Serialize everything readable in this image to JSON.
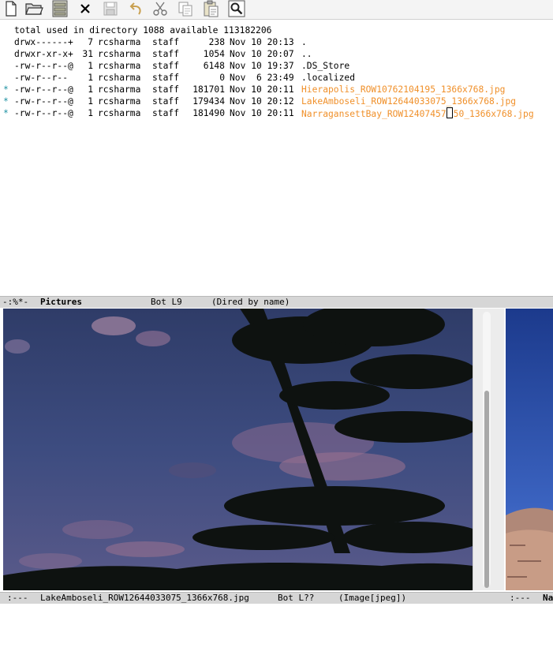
{
  "toolbar": {
    "buttons": [
      {
        "name": "new-file-icon"
      },
      {
        "name": "open-folder-icon"
      },
      {
        "name": "dired-cabinet-icon"
      },
      {
        "name": "close-icon"
      },
      {
        "name": "save-icon"
      },
      {
        "name": "undo-icon"
      },
      {
        "name": "cut-icon"
      },
      {
        "name": "copy-icon"
      },
      {
        "name": "paste-icon"
      },
      {
        "name": "search-icon"
      }
    ]
  },
  "dired": {
    "header": "total used in directory 1088 available 113182206",
    "rows": [
      {
        "mark": "",
        "perm": "drwx------+",
        "links": "7",
        "owner": "rcsharma",
        "group": "staff",
        "size": "238",
        "date": "Nov 10 20:13",
        "name": ".",
        "is_image": false
      },
      {
        "mark": "",
        "perm": "drwxr-xr-x+",
        "links": "31",
        "owner": "rcsharma",
        "group": "staff",
        "size": "1054",
        "date": "Nov 10 20:07",
        "name": "..",
        "is_image": false
      },
      {
        "mark": "",
        "perm": "-rw-r--r--@",
        "links": "1",
        "owner": "rcsharma",
        "group": "staff",
        "size": "6148",
        "date": "Nov 10 19:37",
        "name": ".DS_Store",
        "is_image": false
      },
      {
        "mark": "",
        "perm": "-rw-r--r--",
        "links": "1",
        "owner": "rcsharma",
        "group": "staff",
        "size": "0",
        "date": "Nov  6 23:49",
        "name": ".localized",
        "is_image": false
      },
      {
        "mark": "*",
        "perm": "-rw-r--r--@",
        "links": "1",
        "owner": "rcsharma",
        "group": "staff",
        "size": "181701",
        "date": "Nov 10 20:11",
        "name": "Hierapolis_ROW10762104195_1366x768.jpg",
        "is_image": true
      },
      {
        "mark": "*",
        "perm": "-rw-r--r--@",
        "links": "1",
        "owner": "rcsharma",
        "group": "staff",
        "size": "179434",
        "date": "Nov 10 20:12",
        "name": "LakeAmboseli_ROW12644033075_1366x768.jpg",
        "is_image": true
      },
      {
        "mark": "*",
        "perm": "-rw-r--r--@",
        "links": "1",
        "owner": "rcsharma",
        "group": "staff",
        "size": "181490",
        "date": "Nov 10 20:11",
        "name_before_cursor": "NarragansettBay_ROW12407457",
        "name_after_cursor": "50_1366x768.jpg",
        "is_image": true
      }
    ]
  },
  "modeline_top": {
    "status": "-:%*-",
    "buffer": "Pictures",
    "position": "Bot L9",
    "mode": "(Dired by name)"
  },
  "modeline_bottom": {
    "status": ":---",
    "buffer": "LakeAmboseli_ROW12644033075_1366x768.jpg",
    "position": "Bot L??",
    "mode": "(Image[jpeg])",
    "right_status": ":---",
    "right_buffer": "Na"
  },
  "colors": {
    "image_file": "#f0902a",
    "mark": "#1a8fa0",
    "modeline_bg": "#d6d6d6",
    "sky": "#3a4a78"
  },
  "image_pane": {
    "icon": "photo-lake-amboseli"
  },
  "right_pane": {
    "icon": "photo-narragansett-bay"
  }
}
